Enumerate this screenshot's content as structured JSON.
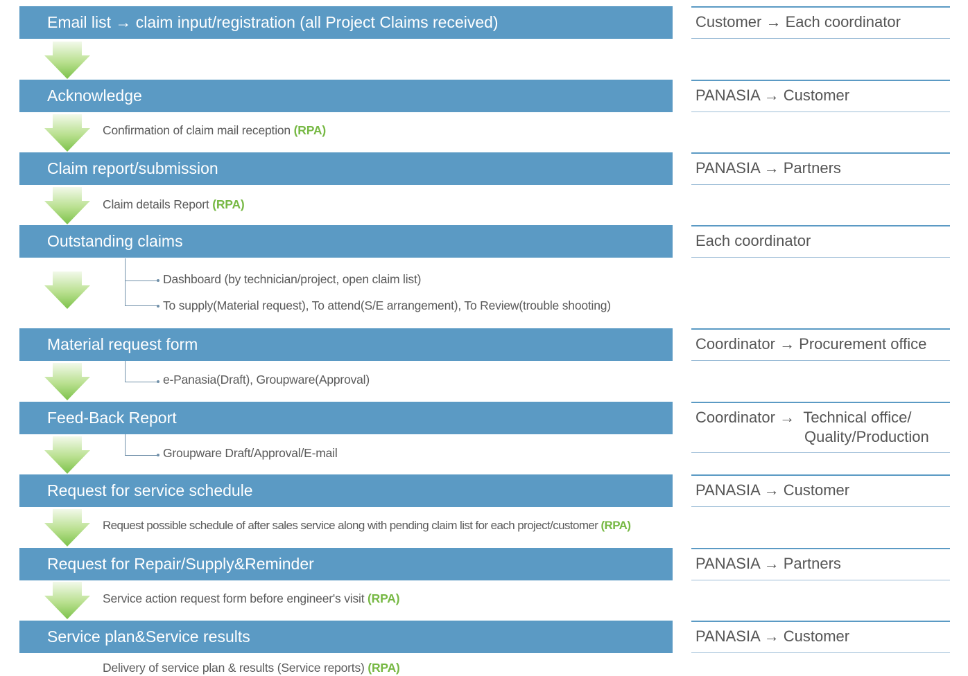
{
  "steps": [
    {
      "title": "Email list → claim input/registration (all Project Claims received)",
      "role": "Customer → Each coordinator"
    },
    {
      "title": "Acknowledge",
      "role": "PANASIA → Customer",
      "note": "Confirmation of claim mail reception",
      "tag": "(RPA)"
    },
    {
      "title": "Claim report/submission",
      "role": "PANASIA → Partners",
      "note": "Claim details Report",
      "tag": "(RPA)"
    },
    {
      "title": "Outstanding claims",
      "role": "Each coordinator",
      "subitems": [
        "Dashboard (by technician/project, open claim list)",
        "To supply(Material request), To attend(S/E arrangement), To Review(trouble shooting)"
      ]
    },
    {
      "title": "Material request form",
      "role": "Coordinator → Procurement office",
      "subitems": [
        "e-Panasia(Draft), Groupware(Approval)"
      ]
    },
    {
      "title": "Feed-Back Report",
      "role": "Coordinator →",
      "role_line1_rest": "Technical office/",
      "role_line2": "Quality/Production",
      "subitems": [
        "Groupware Draft/Approval/E-mail"
      ]
    },
    {
      "title": "Request for service schedule",
      "role": "PANASIA → Customer",
      "note": "Request possible schedule of after sales service along with pending claim list for each project/customer",
      "tag": "(RPA)"
    },
    {
      "title": "Request for Repair/Supply&Reminder",
      "role": "PANASIA → Partners",
      "note": "Service action request form before engineer's visit",
      "tag": "(RPA)"
    },
    {
      "title": "Service plan&Service results",
      "role": "PANASIA → Customer",
      "note": "Delivery of service plan & results (Service reports)",
      "tag": "(RPA)"
    }
  ],
  "colors": {
    "bar": "#5b9ac4",
    "rpa": "#76b843",
    "arrow": "#8fcc5a"
  }
}
